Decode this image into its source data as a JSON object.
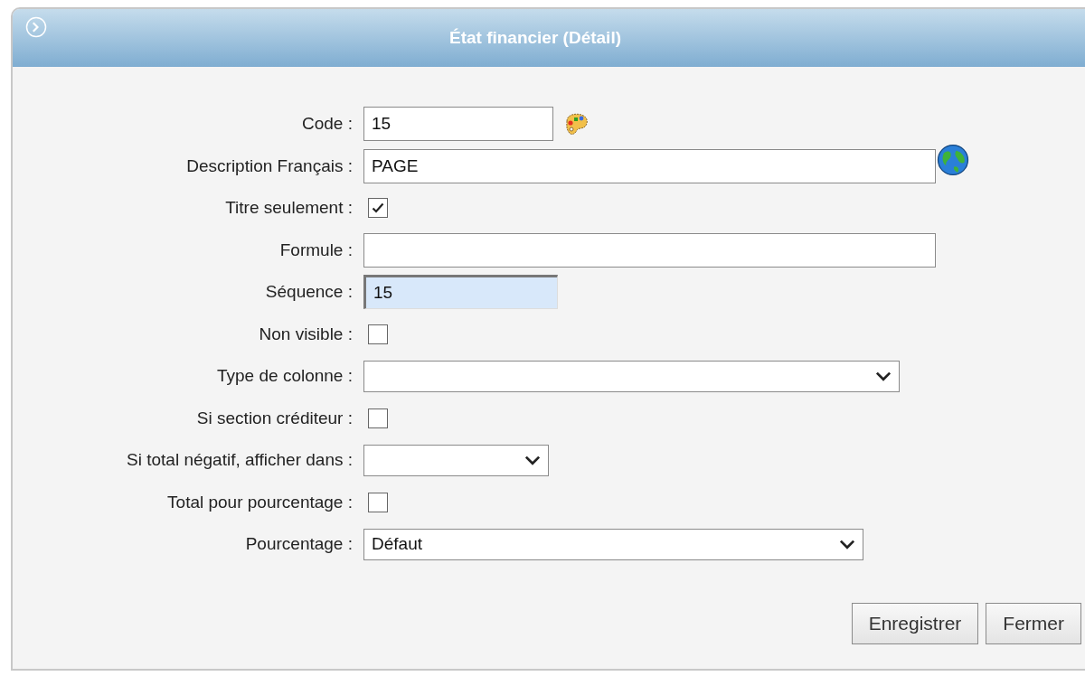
{
  "window": {
    "title": "État financier (Détail)"
  },
  "fields": [
    {
      "label": "Code :",
      "kind": "text",
      "value": "15"
    },
    {
      "label": "Description Français :",
      "kind": "text",
      "value": "PAGE"
    },
    {
      "label": "Titre seulement :",
      "kind": "checkbox",
      "checked": true
    },
    {
      "label": "Formule :",
      "kind": "text"
    },
    {
      "label": "Séquence :",
      "kind": "text",
      "value": "15",
      "readonly": true
    },
    {
      "label": "Non visible :",
      "kind": "checkbox",
      "checked": false
    },
    {
      "label": "Type de colonne :",
      "kind": "select"
    },
    {
      "label": "Si section créditeur :",
      "kind": "checkbox",
      "checked": false
    },
    {
      "label": "Si total négatif, afficher dans :",
      "kind": "select"
    },
    {
      "label": "Total pour pourcentage :",
      "kind": "checkbox",
      "checked": false
    },
    {
      "label": "Pourcentage :",
      "kind": "select",
      "value": "Défaut"
    }
  ],
  "buttons": [
    "Enregistrer",
    "Fermer"
  ]
}
